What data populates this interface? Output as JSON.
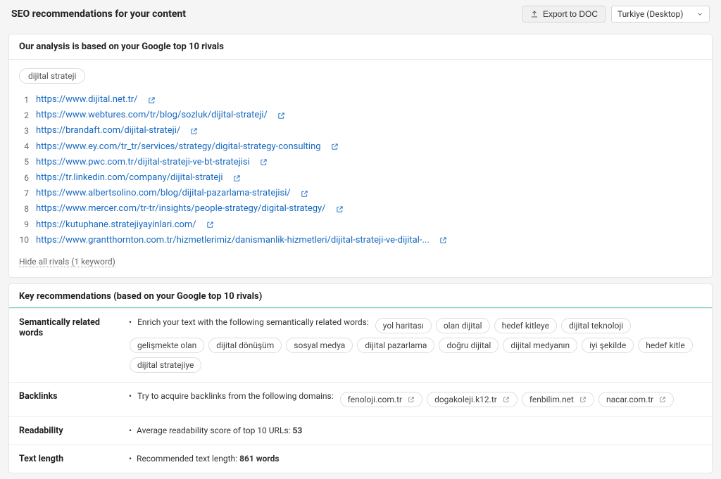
{
  "header": {
    "title": "SEO recommendations for your content",
    "export_label": "Export to DOC",
    "region": "Turkiye (Desktop)"
  },
  "rivals_card": {
    "heading": "Our analysis is based on your Google top 10 rivals",
    "keyword_tag": "dijital strateji",
    "hide_link": "Hide all rivals (1 keyword)",
    "rivals": [
      {
        "n": "1",
        "url": "https://www.dijital.net.tr/"
      },
      {
        "n": "2",
        "url": "https://www.webtures.com/tr/blog/sozluk/dijital-strateji/"
      },
      {
        "n": "3",
        "url": "https://brandaft.com/dijital-strateji/"
      },
      {
        "n": "4",
        "url": "https://www.ey.com/tr_tr/services/strategy/digital-strategy-consulting"
      },
      {
        "n": "5",
        "url": "https://www.pwc.com.tr/dijital-strateji-ve-bt-stratejisi"
      },
      {
        "n": "6",
        "url": "https://tr.linkedin.com/company/dijital-strateji"
      },
      {
        "n": "7",
        "url": "https://www.albertsolino.com/blog/dijital-pazarlama-stratejisi/"
      },
      {
        "n": "8",
        "url": "https://www.mercer.com/tr-tr/insights/people-strategy/digital-strategy/"
      },
      {
        "n": "9",
        "url": "https://kutuphane.stratejiyayinlari.com/"
      },
      {
        "n": "10",
        "url": "https://www.grantthornton.com.tr/hizmetlerimiz/danismanlik-hizmetleri/dijital-strateji-ve-dijital-..."
      }
    ]
  },
  "key_card": {
    "heading": "Key recommendations (based on your Google top 10 rivals)",
    "semantic": {
      "label": "Semantically related words",
      "intro": "Enrich your text with the following semantically related words:",
      "words": [
        "yol haritası",
        "olan dijital",
        "hedef kitleye",
        "dijital teknoloji",
        "gelişmekte olan",
        "dijital dönüşüm",
        "sosyal medya",
        "dijital pazarlama",
        "doğru dijital",
        "dijital medyanın",
        "iyi şekilde",
        "hedef kitle",
        "dijital stratejiye"
      ]
    },
    "backlinks": {
      "label": "Backlinks",
      "intro": "Try to acquire backlinks from the following domains:",
      "domains": [
        "fenoloji.com.tr",
        "dogakoleji.k12.tr",
        "fenbilim.net",
        "nacar.com.tr"
      ]
    },
    "readability": {
      "label": "Readability",
      "text_prefix": "Average readability score of top 10 URLs: ",
      "value": "53"
    },
    "textlength": {
      "label": "Text length",
      "text_prefix": "Recommended text length: ",
      "value": "861 words"
    }
  }
}
